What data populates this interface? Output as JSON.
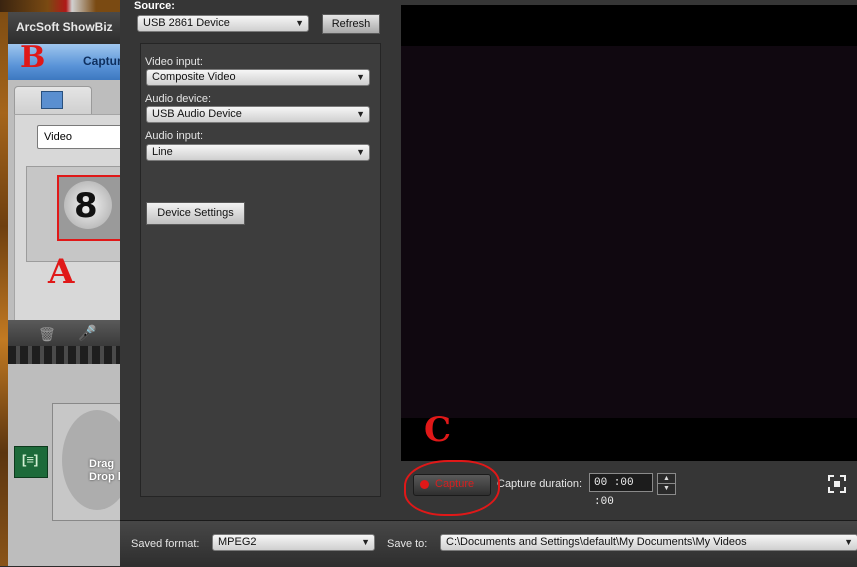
{
  "background_app": {
    "title": "ArcSoft ShowBiz",
    "header_partial": "Captur",
    "media_type_value": "Video",
    "countdown_digit": "8",
    "drag_hint": "Drag\nDrop h"
  },
  "annotations": {
    "a": "A",
    "b": "B",
    "c": "C",
    "color": "#e01818"
  },
  "source": {
    "label": "Source:",
    "device": "USB 2861 Device",
    "refresh_label": "Refresh"
  },
  "settings": {
    "video_input_label": "Video input:",
    "video_input_value": "Composite Video",
    "audio_device_label": "Audio device:",
    "audio_device_value": "USB Audio Device",
    "audio_input_label": "Audio input:",
    "audio_input_value": "Line",
    "device_settings_label": "Device Settings"
  },
  "capture": {
    "capture_label": "Capture",
    "duration_label": "Capture duration:",
    "duration_value": "00 :00 :00",
    "icons": [
      "record-dot-icon",
      "spin-up-icon",
      "spin-down-icon",
      "fullscreen-icon"
    ]
  },
  "bottom": {
    "saved_format_label": "Saved format:",
    "saved_format_value": "MPEG2",
    "save_to_label": "Save to:",
    "save_to_value": "C:\\Documents and Settings\\default\\My Documents\\My Videos"
  },
  "colors": {
    "capture_red": "#d42020",
    "panel_dark": "#363636",
    "preview_bg": "#100810"
  }
}
